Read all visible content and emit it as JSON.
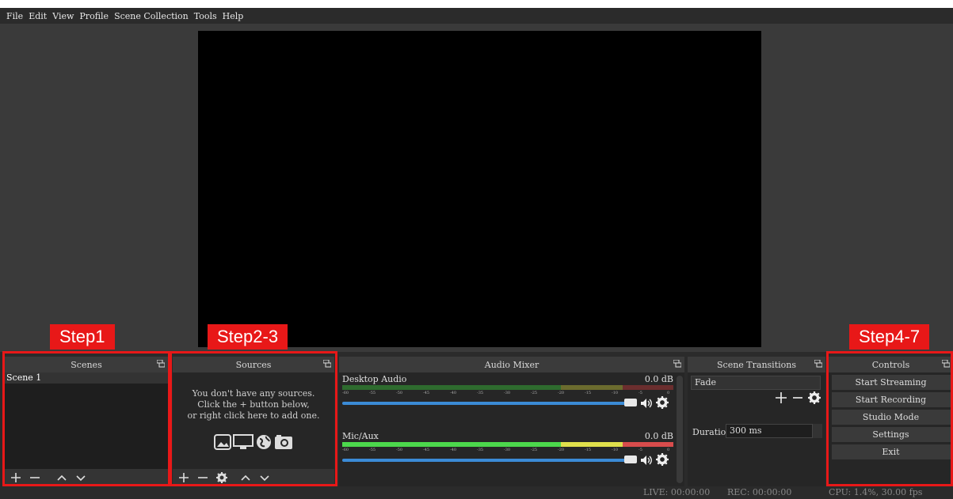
{
  "menu": [
    "File",
    "Edit",
    "View",
    "Profile",
    "Scene Collection",
    "Tools",
    "Help"
  ],
  "scenes": {
    "title": "Scenes",
    "items": [
      "Scene 1"
    ]
  },
  "sources": {
    "title": "Sources",
    "hint_1": "You don't have any sources.",
    "hint_2": "Click the + button below,",
    "hint_3": "or right click here to add one."
  },
  "mixer": {
    "title": "Audio Mixer",
    "channels": [
      {
        "name": "Desktop Audio",
        "db": "0.0 dB"
      },
      {
        "name": "Mic/Aux",
        "db": "0.0 dB"
      }
    ],
    "scale": [
      "-60",
      "-55",
      "-50",
      "-45",
      "-40",
      "-35",
      "-30",
      "-25",
      "-20",
      "-15",
      "-10",
      "-5",
      "0"
    ]
  },
  "transitions": {
    "title": "Scene Transitions",
    "selected": "Fade",
    "duration_label": "Duration",
    "duration_value": "300 ms"
  },
  "controls": {
    "title": "Controls",
    "buttons": [
      "Start Streaming",
      "Start Recording",
      "Studio Mode",
      "Settings",
      "Exit"
    ]
  },
  "status": {
    "live": "LIVE: 00:00:00",
    "rec": "REC: 00:00:00",
    "cpu": "CPU: 1.4%, 30.00 fps"
  },
  "annotations": {
    "step1": "Step1",
    "step2": "Step2-3",
    "step3": "Step4-7"
  },
  "colors": {
    "accent": "#e81818",
    "fader": "#3b8bd6"
  }
}
